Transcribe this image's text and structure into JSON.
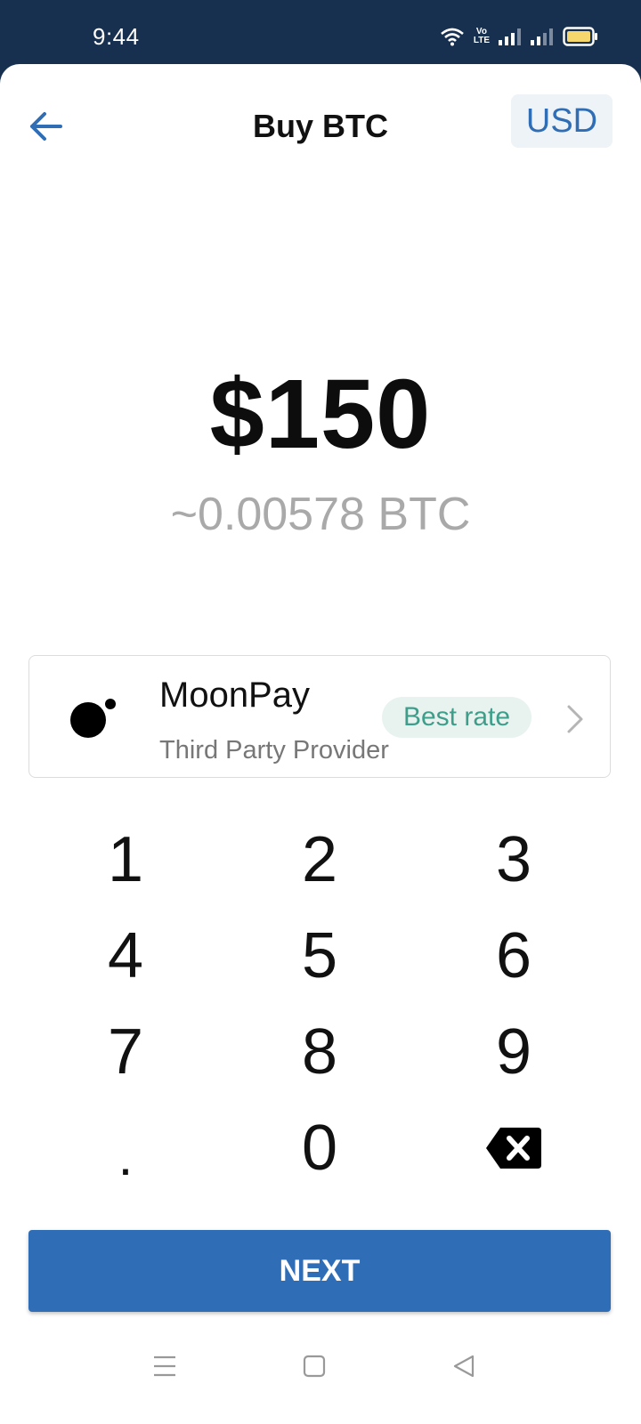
{
  "status_bar": {
    "time": "9:44",
    "volte_label": "Vo\nLTE"
  },
  "header": {
    "title": "Buy BTC",
    "currency": "USD",
    "back_icon": "arrow-left-icon"
  },
  "amount": {
    "fiat": "$150",
    "crypto": "~0.00578 BTC"
  },
  "provider": {
    "name": "MoonPay",
    "subtitle": "Third Party Provider",
    "badge": "Best rate",
    "logo_icon": "moonpay-logo-icon",
    "chevron_icon": "chevron-right-icon"
  },
  "keypad": {
    "k1": "1",
    "k2": "2",
    "k3": "3",
    "k4": "4",
    "k5": "5",
    "k6": "6",
    "k7": "7",
    "k8": "8",
    "k9": "9",
    "dot": ".",
    "k0": "0",
    "backspace_icon": "backspace-icon"
  },
  "next_label": "NEXT",
  "colors": {
    "status_bg": "#17304f",
    "accent": "#2f6eb6",
    "badge_text": "#3d9e8a",
    "badge_bg": "#e8f3f0"
  }
}
